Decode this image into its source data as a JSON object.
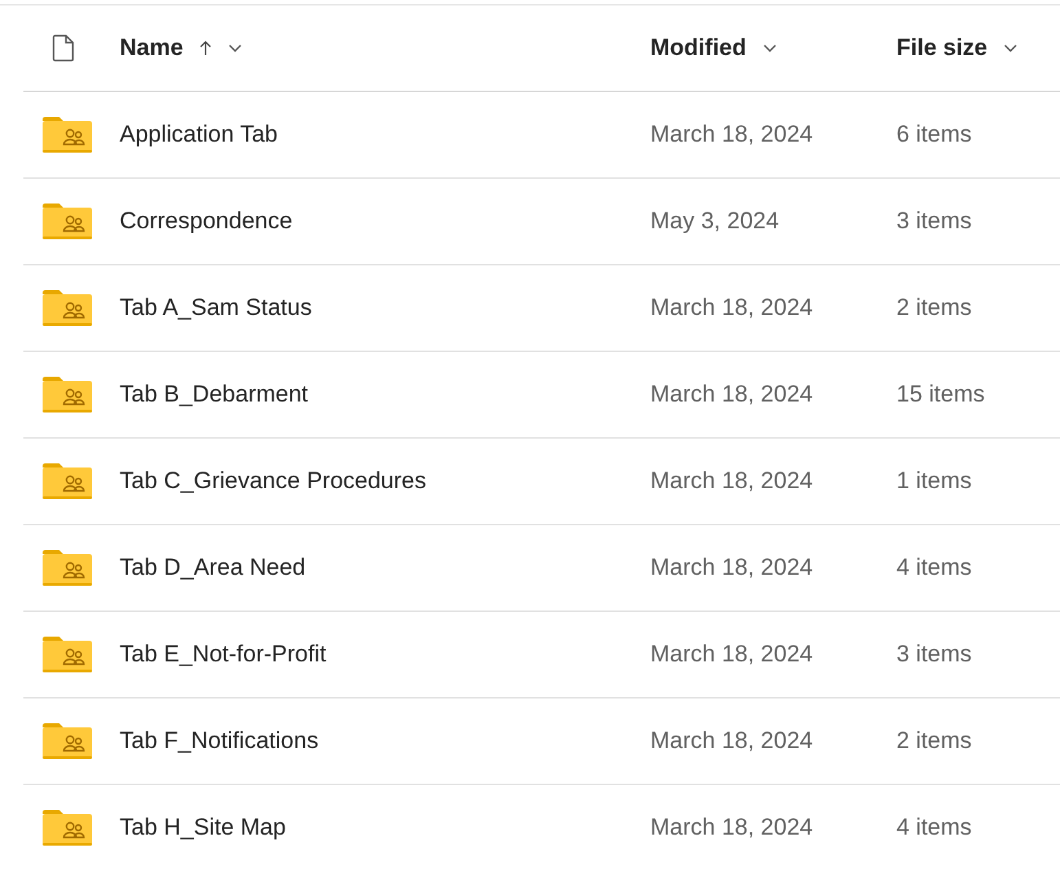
{
  "columns": [
    {
      "label": "Name",
      "sorted_ascending": true
    },
    {
      "label": "Modified",
      "sorted_ascending": false
    },
    {
      "label": "File size",
      "sorted_ascending": false
    }
  ],
  "rows": [
    {
      "name": "Application Tab",
      "modified": "March 18, 2024",
      "size": "6 items"
    },
    {
      "name": "Correspondence",
      "modified": "May 3, 2024",
      "size": "3 items"
    },
    {
      "name": "Tab A_Sam Status",
      "modified": "March 18, 2024",
      "size": "2 items"
    },
    {
      "name": "Tab B_Debarment",
      "modified": "March 18, 2024",
      "size": "15 items"
    },
    {
      "name": "Tab C_Grievance Procedures",
      "modified": "March 18, 2024",
      "size": "1 items"
    },
    {
      "name": "Tab D_Area Need",
      "modified": "March 18, 2024",
      "size": "4 items"
    },
    {
      "name": "Tab E_Not-for-Profit",
      "modified": "March 18, 2024",
      "size": "3 items"
    },
    {
      "name": "Tab F_Notifications",
      "modified": "March 18, 2024",
      "size": "2 items"
    },
    {
      "name": "Tab H_Site Map",
      "modified": "March 18, 2024",
      "size": "4 items"
    }
  ]
}
